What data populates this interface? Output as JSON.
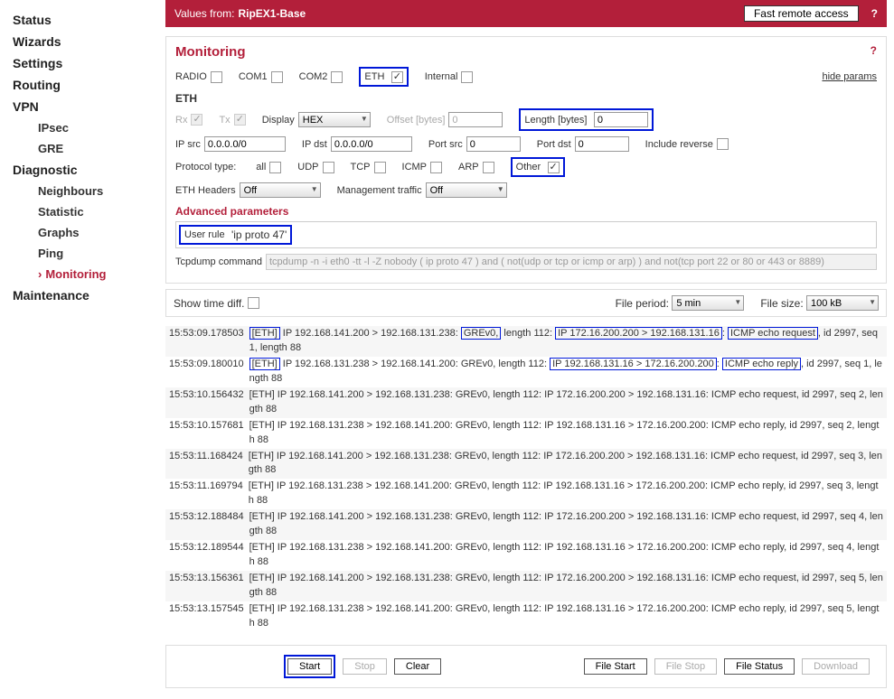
{
  "topbar": {
    "values_from": "Values from:",
    "unit": "RipEX1-Base",
    "fast": "Fast remote access",
    "help": "?"
  },
  "nav": {
    "status": "Status",
    "wizards": "Wizards",
    "settings": "Settings",
    "routing": "Routing",
    "vpn": "VPN",
    "ipsec": "IPsec",
    "gre": "GRE",
    "diagnostic": "Diagnostic",
    "neighbours": "Neighbours",
    "statistic": "Statistic",
    "graphs": "Graphs",
    "ping": "Ping",
    "monitoring": "Monitoring",
    "maintenance": "Maintenance"
  },
  "monitor": {
    "title": "Monitoring",
    "help": "?",
    "hide": "hide params",
    "ifaces": {
      "radio": "RADIO",
      "com1": "COM1",
      "com2": "COM2",
      "eth": "ETH",
      "internal": "Internal"
    },
    "eth_head": "ETH",
    "rx": "Rx",
    "tx": "Tx",
    "display": "Display",
    "display_val": "HEX",
    "offset": "Offset [bytes]",
    "offset_val": "0",
    "length_label": "Length [bytes]",
    "length_val": "0",
    "ipsrc": "IP src",
    "ipsrc_val": "0.0.0.0/0",
    "ipdst": "IP dst",
    "ipdst_val": "0.0.0.0/0",
    "portsrc": "Port src",
    "portsrc_val": "0",
    "portdst": "Port dst",
    "portdst_val": "0",
    "include_rev": "Include reverse",
    "proto_label": "Protocol type:",
    "all": "all",
    "udp": "UDP",
    "tcp": "TCP",
    "icmp": "ICMP",
    "arp": "ARP",
    "other": "Other",
    "ethhdr": "ETH Headers",
    "ethhdr_val": "Off",
    "mgmt": "Management traffic",
    "mgmt_val": "Off",
    "adv": "Advanced parameters",
    "user_rule": "User rule",
    "user_rule_val": "'ip proto 47'",
    "tcpdump": "Tcpdump command",
    "tcpdump_val": "tcpdump -n -i eth0 -tt -l -Z nobody ( ip proto 47 ) and ( not(udp or tcp or icmp or arp) ) and not(tcp port 22 or 80 or 443 or 8889)",
    "showtime": "Show time diff.",
    "fileperiod": "File period:",
    "fileperiod_val": "5 min",
    "filesize": "File size:",
    "filesize_val": "100 kB"
  },
  "log": [
    {
      "ts": "15:53:09.178503",
      "parts": [
        [
          "bx",
          "[ETH]"
        ],
        [
          "t",
          " IP 192.168.141.200 > 192.168.131.238: "
        ],
        [
          "bx",
          "GREv0,"
        ],
        [
          "t",
          " length 112: "
        ],
        [
          "bx",
          "IP 172.16.200.200 > 192.168.131.16"
        ],
        [
          "t",
          ": "
        ],
        [
          "bx",
          "ICMP echo request"
        ],
        [
          "t",
          ", id 2997, seq 1, length 88"
        ]
      ]
    },
    {
      "ts": "15:53:09.180010",
      "parts": [
        [
          "bx",
          "[ETH]"
        ],
        [
          "t",
          " IP 192.168.131.238 > 192.168.141.200: GREv0, length 112: "
        ],
        [
          "bx",
          "IP 192.168.131.16 > 172.16.200.200"
        ],
        [
          "t",
          ": "
        ],
        [
          "bx",
          "ICMP echo reply"
        ],
        [
          "t",
          ", id 2997, seq 1, length 88"
        ]
      ]
    },
    {
      "ts": "15:53:10.156432",
      "parts": [
        [
          "t",
          "[ETH] IP 192.168.141.200 > 192.168.131.238: GREv0, length 112: IP 172.16.200.200 > 192.168.131.16: ICMP echo request, id 2997, seq 2, length 88"
        ]
      ]
    },
    {
      "ts": "15:53:10.157681",
      "parts": [
        [
          "t",
          "[ETH] IP 192.168.131.238 > 192.168.141.200: GREv0, length 112: IP 192.168.131.16 > 172.16.200.200: ICMP echo reply, id 2997, seq 2, length 88"
        ]
      ]
    },
    {
      "ts": "15:53:11.168424",
      "parts": [
        [
          "t",
          "[ETH] IP 192.168.141.200 > 192.168.131.238: GREv0, length 112: IP 172.16.200.200 > 192.168.131.16: ICMP echo request, id 2997, seq 3, length 88"
        ]
      ]
    },
    {
      "ts": "15:53:11.169794",
      "parts": [
        [
          "t",
          "[ETH] IP 192.168.131.238 > 192.168.141.200: GREv0, length 112: IP 192.168.131.16 > 172.16.200.200: ICMP echo reply, id 2997, seq 3, length 88"
        ]
      ]
    },
    {
      "ts": "15:53:12.188484",
      "parts": [
        [
          "t",
          "[ETH] IP 192.168.141.200 > 192.168.131.238: GREv0, length 112: IP 172.16.200.200 > 192.168.131.16: ICMP echo request, id 2997, seq 4, length 88"
        ]
      ]
    },
    {
      "ts": "15:53:12.189544",
      "parts": [
        [
          "t",
          "[ETH] IP 192.168.131.238 > 192.168.141.200: GREv0, length 112: IP 192.168.131.16 > 172.16.200.200: ICMP echo reply, id 2997, seq 4, length 88"
        ]
      ]
    },
    {
      "ts": "15:53:13.156361",
      "parts": [
        [
          "t",
          "[ETH] IP 192.168.141.200 > 192.168.131.238: GREv0, length 112: IP 172.16.200.200 > 192.168.131.16: ICMP echo request, id 2997, seq 5, length 88"
        ]
      ]
    },
    {
      "ts": "15:53:13.157545",
      "parts": [
        [
          "t",
          "[ETH] IP 192.168.131.238 > 192.168.141.200: GREv0, length 112: IP 192.168.131.16 > 172.16.200.200: ICMP echo reply, id 2997, seq 5, length 88"
        ]
      ]
    }
  ],
  "buttons": {
    "start": "Start",
    "stop": "Stop",
    "clear": "Clear",
    "filestart": "File Start",
    "filestop": "File Stop",
    "filestatus": "File Status",
    "download": "Download"
  }
}
